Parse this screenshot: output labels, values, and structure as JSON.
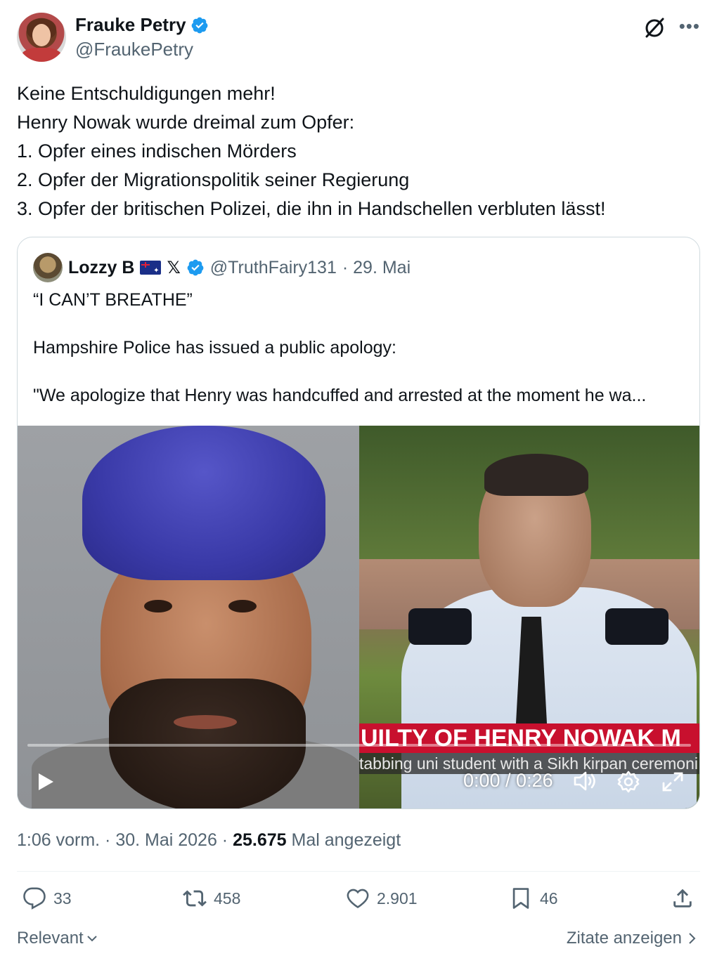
{
  "author": {
    "name": "Frauke Petry",
    "handle": "@FraukePetry"
  },
  "tweet": {
    "lines": [
      "Keine Entschuldigungen mehr!",
      "Henry Nowak wurde dreimal zum Opfer:",
      "1. Opfer eines indischen Mörders",
      "2. Opfer der Migrationspolitik seiner Regierung",
      "3. Opfer der britischen Polizei, die ihn in Handschellen verbluten lässt!"
    ]
  },
  "quote": {
    "name": "Lozzy B",
    "x_mark": "𝕏",
    "handle": "@TruthFairy131",
    "date": "· 29. Mai",
    "paragraphs": [
      "“I CAN’T BREATHE”",
      "Hampshire Police has issued a public apology:",
      "\"We apologize that Henry was handcuffed and arrested at the moment he wa..."
    ],
    "video": {
      "ticker": "UILTY OF HENRY NOWAK M",
      "subticker": "tabbing uni student with a Sikh kirpan ceremoni",
      "time": "0:00 / 0:26"
    }
  },
  "meta": {
    "time_date": "1:06 vorm. · 30. Mai 2026 · ",
    "views": "25.675",
    "views_label": " Mal angezeigt"
  },
  "actions": {
    "replies": "33",
    "reposts": "458",
    "likes": "2.901",
    "bookmarks": "46"
  },
  "footer": {
    "sort_label": "Relevant",
    "quotes_label": "Zitate anzeigen"
  },
  "colors": {
    "accent": "#1d9bf0",
    "secondary_text": "#536471",
    "ticker_red": "#c8102e"
  }
}
